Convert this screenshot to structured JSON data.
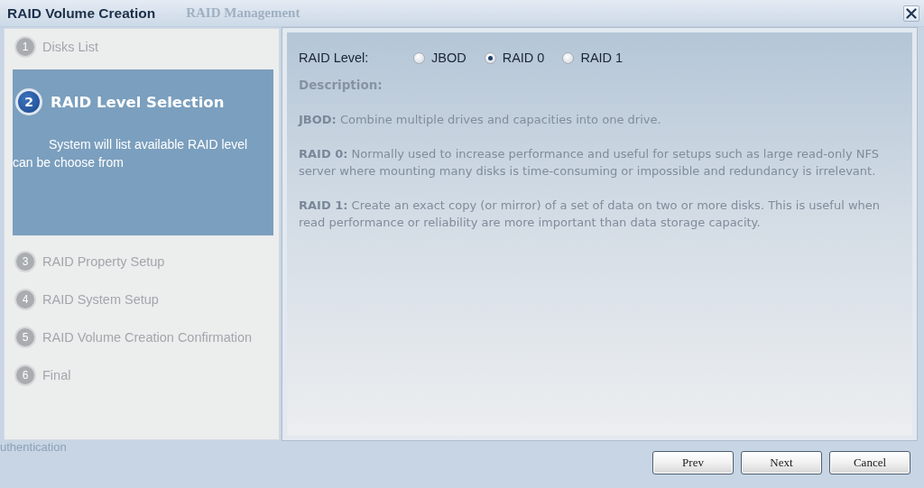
{
  "window": {
    "title": "RAID Volume Creation"
  },
  "background_window": {
    "title": "RAID Management",
    "label": "uthentication"
  },
  "steps": [
    {
      "number": "1",
      "label": "Disks List",
      "selected": false
    },
    {
      "number": "2",
      "label": "RAID Level Selection",
      "selected": true,
      "description": "System will list available RAID level can be choose from"
    },
    {
      "number": "3",
      "label": "RAID Property Setup",
      "selected": false
    },
    {
      "number": "4",
      "label": "RAID System Setup",
      "selected": false
    },
    {
      "number": "5",
      "label": "RAID Volume Creation Confirmation",
      "selected": false
    },
    {
      "number": "6",
      "label": "Final",
      "selected": false
    }
  ],
  "raid_level": {
    "label": "RAID Level:",
    "options": [
      {
        "label": "JBOD",
        "selected": false
      },
      {
        "label": "RAID 0",
        "selected": true
      },
      {
        "label": "RAID 1",
        "selected": false
      }
    ]
  },
  "description": {
    "heading": "Description:",
    "paragraphs": [
      "**JBOD:** Combine multiple drives and capacities into one drive.",
      "**RAID 0:** Normally used to increase performance and useful for setups such as large read-only NFS server where mounting many disks is time-consuming or impossible and redundancy is irrelevant.",
      "**RAID 1:** Create an exact copy (or mirror) of a set of data on two or more disks. This is useful when read performance or reliability are more important than data storage capacity."
    ]
  },
  "buttons": [
    "Prev",
    "Next",
    "Cancel"
  ]
}
